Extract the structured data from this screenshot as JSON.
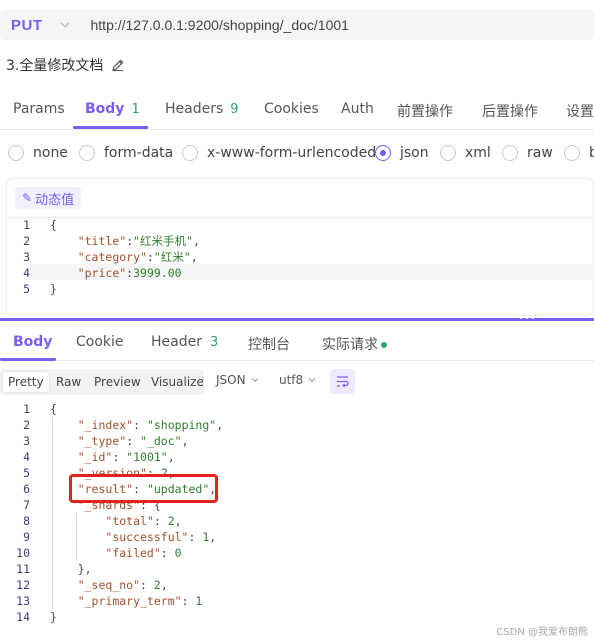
{
  "request": {
    "method": "PUT",
    "url": "http://127.0.0.1:9200/shopping/_doc/1001",
    "title": "3.全量修改文档"
  },
  "tabs": [
    {
      "label": "Params"
    },
    {
      "label": "Body",
      "count": "1"
    },
    {
      "label": "Headers",
      "count": "9"
    },
    {
      "label": "Cookies"
    },
    {
      "label": "Auth"
    },
    {
      "label": "前置操作"
    },
    {
      "label": "后置操作"
    },
    {
      "label": "设置"
    }
  ],
  "body_types": [
    "none",
    "form-data",
    "x-www-form-urlencoded",
    "json",
    "xml",
    "raw",
    "b"
  ],
  "body_type_selected": "json",
  "dynamic_button": "动态值",
  "request_body": [
    {
      "ln": "1",
      "parts": [
        [
          "p",
          "{"
        ]
      ]
    },
    {
      "ln": "2",
      "parts": [
        [
          "p",
          "    "
        ],
        [
          "k",
          "\"title\""
        ],
        [
          "p",
          ":"
        ],
        [
          "s",
          "\"红米手机\""
        ],
        [
          "p",
          ","
        ]
      ]
    },
    {
      "ln": "3",
      "parts": [
        [
          "p",
          "    "
        ],
        [
          "k",
          "\"category\""
        ],
        [
          "p",
          ":"
        ],
        [
          "s",
          "\"红米\""
        ],
        [
          "p",
          ","
        ]
      ]
    },
    {
      "ln": "4",
      "parts": [
        [
          "p",
          "    "
        ],
        [
          "k",
          "\"price\""
        ],
        [
          "p",
          ":"
        ],
        [
          "n",
          "3999.00"
        ]
      ]
    },
    {
      "ln": "5",
      "parts": [
        [
          "p",
          "}"
        ]
      ]
    }
  ],
  "response_tabs": [
    {
      "label": "Body"
    },
    {
      "label": "Cookie"
    },
    {
      "label": "Header",
      "count": "3"
    },
    {
      "label": "控制台"
    },
    {
      "label": "实际请求"
    }
  ],
  "response_toolbar": {
    "views": [
      "Pretty",
      "Raw",
      "Preview",
      "Visualize"
    ],
    "format": "JSON",
    "encoding": "utf8"
  },
  "response_body": [
    {
      "ln": "1",
      "parts": [
        [
          "p",
          "{"
        ]
      ]
    },
    {
      "ln": "2",
      "parts": [
        [
          "p",
          "    "
        ],
        [
          "k",
          "\"_index\""
        ],
        [
          "p",
          ": "
        ],
        [
          "s",
          "\"shopping\""
        ],
        [
          "p",
          ","
        ]
      ]
    },
    {
      "ln": "3",
      "parts": [
        [
          "p",
          "    "
        ],
        [
          "k",
          "\"_type\""
        ],
        [
          "p",
          ": "
        ],
        [
          "s",
          "\"_doc\""
        ],
        [
          "p",
          ","
        ]
      ]
    },
    {
      "ln": "4",
      "parts": [
        [
          "p",
          "    "
        ],
        [
          "k",
          "\"_id\""
        ],
        [
          "p",
          ": "
        ],
        [
          "s",
          "\"1001\""
        ],
        [
          "p",
          ","
        ]
      ]
    },
    {
      "ln": "5",
      "parts": [
        [
          "p",
          "    "
        ],
        [
          "k",
          "\"_version\""
        ],
        [
          "p",
          ": "
        ],
        [
          "n",
          "2"
        ],
        [
          "p",
          ","
        ]
      ]
    },
    {
      "ln": "6",
      "parts": [
        [
          "p",
          "    "
        ],
        [
          "k",
          "\"result\""
        ],
        [
          "p",
          ": "
        ],
        [
          "s",
          "\"updated\""
        ],
        [
          "p",
          ","
        ]
      ]
    },
    {
      "ln": "7",
      "parts": [
        [
          "p",
          "    "
        ],
        [
          "k",
          "\"_shards\""
        ],
        [
          "p",
          ": {"
        ]
      ]
    },
    {
      "ln": "8",
      "parts": [
        [
          "p",
          "        "
        ],
        [
          "k",
          "\"total\""
        ],
        [
          "p",
          ": "
        ],
        [
          "n",
          "2"
        ],
        [
          "p",
          ","
        ]
      ]
    },
    {
      "ln": "9",
      "parts": [
        [
          "p",
          "        "
        ],
        [
          "k",
          "\"successful\""
        ],
        [
          "p",
          ": "
        ],
        [
          "n",
          "1"
        ],
        [
          "p",
          ","
        ]
      ]
    },
    {
      "ln": "10",
      "parts": [
        [
          "p",
          "        "
        ],
        [
          "k",
          "\"failed\""
        ],
        [
          "p",
          ": "
        ],
        [
          "n",
          "0"
        ]
      ]
    },
    {
      "ln": "11",
      "parts": [
        [
          "p",
          "    },"
        ]
      ]
    },
    {
      "ln": "12",
      "parts": [
        [
          "p",
          "    "
        ],
        [
          "k",
          "\"_seq_no\""
        ],
        [
          "p",
          ": "
        ],
        [
          "n",
          "2"
        ],
        [
          "p",
          ","
        ]
      ]
    },
    {
      "ln": "13",
      "parts": [
        [
          "p",
          "    "
        ],
        [
          "k",
          "\"_primary_term\""
        ],
        [
          "p",
          ": "
        ],
        [
          "n",
          "1"
        ]
      ]
    },
    {
      "ln": "14",
      "parts": [
        [
          "p",
          "}"
        ]
      ]
    }
  ],
  "watermark": "CSDN @我爱布朗熊",
  "colors": {
    "accent": "#7a5df5",
    "count_green": "#2aa86b",
    "highlight": "#e0231c"
  }
}
